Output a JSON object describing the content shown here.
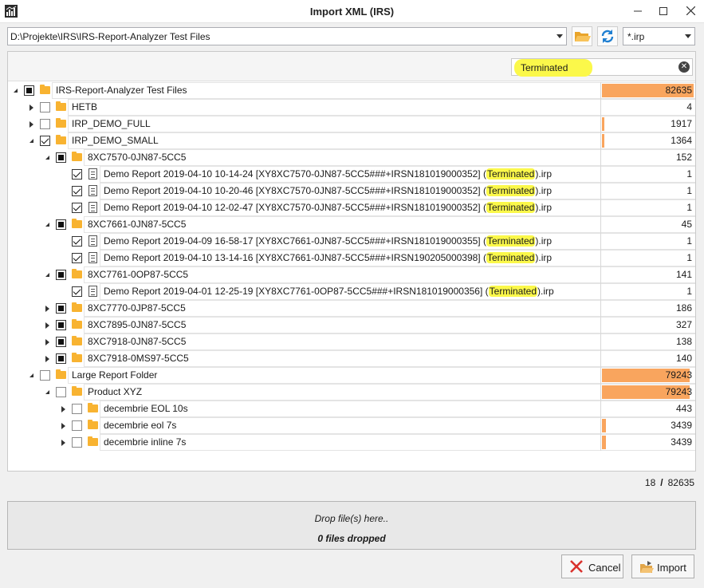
{
  "window": {
    "title": "Import XML (IRS)"
  },
  "toolbar": {
    "path": "D:\\Projekte\\IRS\\IRS-Report-Analyzer Test Files",
    "filter": "*.irp"
  },
  "search": {
    "value": "Terminated"
  },
  "accent_bar_color": "#f9a55e",
  "highlight_color": "#fbf84a",
  "tree": [
    {
      "level": 0,
      "expander": "expanded",
      "check": "partial",
      "icon": "folder",
      "label": "IRS-Report-Analyzer Test Files",
      "count": "82635",
      "fill": 1.0
    },
    {
      "level": 1,
      "expander": "collapsed",
      "check": "empty",
      "icon": "folder",
      "label": "HETB",
      "count": "4",
      "fill": 0
    },
    {
      "level": 1,
      "expander": "collapsed",
      "check": "empty",
      "icon": "folder",
      "label": "IRP_DEMO_FULL",
      "count": "1917",
      "fill": 0.023
    },
    {
      "level": 1,
      "expander": "expanded",
      "check": "checked",
      "icon": "folder",
      "label": "IRP_DEMO_SMALL",
      "count": "1364",
      "fill": 0.017
    },
    {
      "level": 2,
      "expander": "expanded",
      "check": "partial",
      "icon": "folder",
      "label": "8XC7570-0JN87-5CC5",
      "count": "152",
      "fill": 0
    },
    {
      "level": 3,
      "expander": "none",
      "check": "checked",
      "icon": "doc",
      "label": "Demo Report 2019-04-10 10-14-24 [XY8XC7570-0JN87-5CC5###+IRSN181019000352] (",
      "match": "Terminated",
      "suffix": ").irp",
      "count": "1",
      "fill": 0
    },
    {
      "level": 3,
      "expander": "none",
      "check": "checked",
      "icon": "doc",
      "label": "Demo Report 2019-04-10 10-20-46 [XY8XC7570-0JN87-5CC5###+IRSN181019000352] (",
      "match": "Terminated",
      "suffix": ").irp",
      "count": "1",
      "fill": 0
    },
    {
      "level": 3,
      "expander": "none",
      "check": "checked",
      "icon": "doc",
      "label": "Demo Report 2019-04-10 12-02-47 [XY8XC7570-0JN87-5CC5###+IRSN181019000352] (",
      "match": "Terminated",
      "suffix": ").irp",
      "count": "1",
      "fill": 0
    },
    {
      "level": 2,
      "expander": "expanded",
      "check": "partial",
      "icon": "folder",
      "label": "8XC7661-0JN87-5CC5",
      "count": "45",
      "fill": 0
    },
    {
      "level": 3,
      "expander": "none",
      "check": "checked",
      "icon": "doc",
      "label": "Demo Report 2019-04-09 16-58-17 [XY8XC7661-0JN87-5CC5###+IRSN181019000355] (",
      "match": "Terminated",
      "suffix": ").irp",
      "count": "1",
      "fill": 0
    },
    {
      "level": 3,
      "expander": "none",
      "check": "checked",
      "icon": "doc",
      "label": "Demo Report 2019-04-10 13-14-16 [XY8XC7661-0JN87-5CC5###+IRSN190205000398] (",
      "match": "Terminated",
      "suffix": ").irp",
      "count": "1",
      "fill": 0
    },
    {
      "level": 2,
      "expander": "expanded",
      "check": "partial",
      "icon": "folder",
      "label": "8XC7761-0OP87-5CC5",
      "count": "141",
      "fill": 0
    },
    {
      "level": 3,
      "expander": "none",
      "check": "checked",
      "icon": "doc",
      "label": "Demo Report 2019-04-01 12-25-19 [XY8XC7761-0OP87-5CC5###+IRSN181019000356] (",
      "match": "Terminated",
      "suffix": ").irp",
      "count": "1",
      "fill": 0
    },
    {
      "level": 2,
      "expander": "collapsed",
      "check": "partial",
      "icon": "folder",
      "label": "8XC7770-0JP87-5CC5",
      "count": "186",
      "fill": 0
    },
    {
      "level": 2,
      "expander": "collapsed",
      "check": "partial",
      "icon": "folder",
      "label": "8XC7895-0JN87-5CC5",
      "count": "327",
      "fill": 0
    },
    {
      "level": 2,
      "expander": "collapsed",
      "check": "partial",
      "icon": "folder",
      "label": "8XC7918-0JN87-5CC5",
      "count": "138",
      "fill": 0
    },
    {
      "level": 2,
      "expander": "collapsed",
      "check": "partial",
      "icon": "folder",
      "label": "8XC7918-0MS97-5CC5",
      "count": "140",
      "fill": 0
    },
    {
      "level": 1,
      "expander": "expanded",
      "check": "empty",
      "icon": "folder",
      "label": "Large Report Folder",
      "count": "79243",
      "fill": 0.959
    },
    {
      "level": 2,
      "expander": "expanded",
      "check": "empty",
      "icon": "folder",
      "label": "Product XYZ",
      "count": "79243",
      "fill": 0.959
    },
    {
      "level": 3,
      "expander": "collapsed",
      "check": "empty",
      "icon": "folder",
      "label": "decembrie EOL 10s",
      "count": "443",
      "fill": 0
    },
    {
      "level": 3,
      "expander": "collapsed",
      "check": "empty",
      "icon": "folder",
      "label": "decembrie eol 7s",
      "count": "3439",
      "fill": 0.042
    },
    {
      "level": 3,
      "expander": "collapsed",
      "check": "empty",
      "icon": "folder",
      "label": "decembrie inline 7s",
      "count": "3439",
      "fill": 0.042
    }
  ],
  "stats": {
    "shown": "18",
    "separator": "/",
    "total": "82635"
  },
  "dropzone": {
    "hint": "Drop file(s) here..",
    "count": "0 files dropped"
  },
  "buttons": {
    "cancel": "Cancel",
    "import": "Import"
  }
}
